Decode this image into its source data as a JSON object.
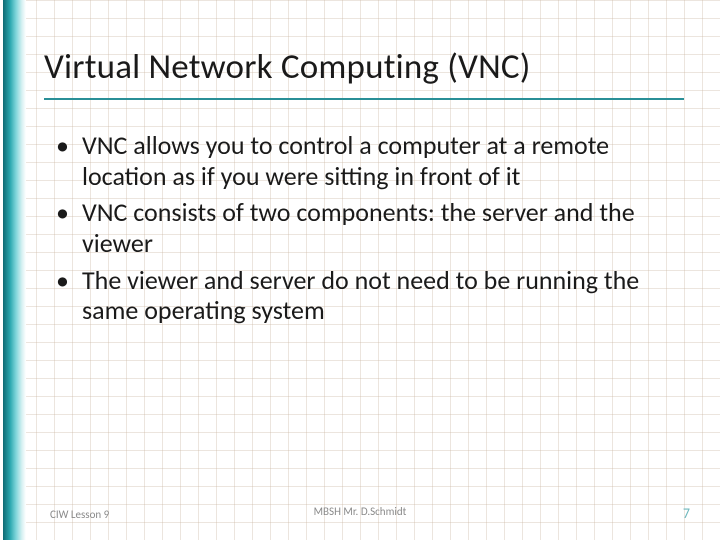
{
  "slide": {
    "title": "Virtual Network Computing (VNC)",
    "bullets": [
      "VNC allows you to control a computer at a remote location as if you were sitting in front of it",
      "VNC consists of two components: the server and the viewer",
      "The viewer and server do not need to be running the same operating system"
    ]
  },
  "footer": {
    "left": "CIW Lesson 9",
    "center": "MBSH Mr. D.Schmidt",
    "page": "7"
  },
  "colors": {
    "accent": "#2a8f97"
  }
}
